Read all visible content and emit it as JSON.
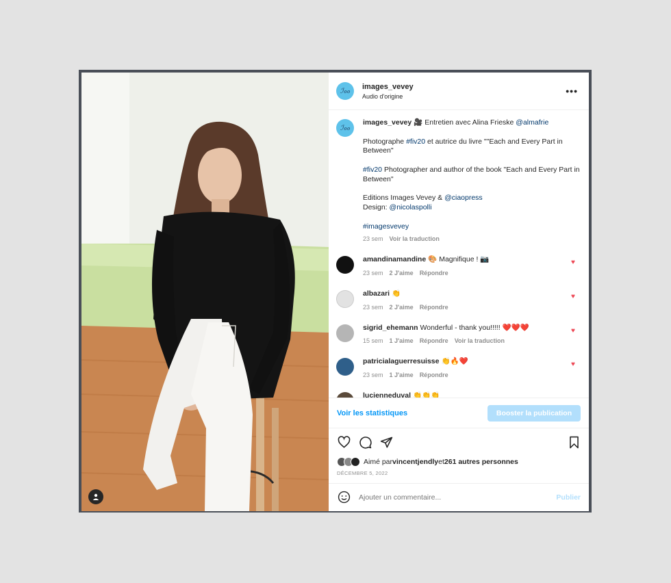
{
  "post": {
    "username": "images_vevey",
    "audio": "Audio d'origine",
    "more": "•••"
  },
  "caption": {
    "username": "images_vevey",
    "emoji": "🎥",
    "line1_text": " Entretien avec Alina Frieske ",
    "line1_mention": "@almafrie",
    "p2_prefix": "Photographe ",
    "p2_tag": "#fiv20",
    "p2_rest": " et autrice du livre \"\"Each and Every Part in Between\"",
    "p3_tag": "#fiv20",
    "p3_rest": " Photographer and author of the book \"Each and Every Part in Between\"",
    "p4_prefix": "Editions Images Vevey & ",
    "p4_mention": "@ciaopress",
    "p5_prefix": "Design: ",
    "p5_mention": "@nicolaspolli",
    "p6_tag": "#imagesvevey",
    "time": "23 sem",
    "translate": "Voir la traduction"
  },
  "comments": [
    {
      "username": "amandinamandine",
      "text": "🎨 Magnifique ! 📷",
      "time": "23 sem",
      "likes": "2 J'aime",
      "reply": "Répondre",
      "translate": "",
      "avatar_color": "#111111"
    },
    {
      "username": "albazari",
      "text": "👏",
      "time": "23 sem",
      "likes": "2 J'aime",
      "reply": "Répondre",
      "translate": "",
      "avatar_color": "#d9d9d9"
    },
    {
      "username": "sigrid_ehemann",
      "text": "Wonderful - thank you!!!!! ❤️❤️❤️",
      "time": "15 sem",
      "likes": "1 J'aime",
      "reply": "Répondre",
      "translate": "Voir la traduction",
      "avatar_color": "#b5b5b5"
    },
    {
      "username": "patricialaguerresuisse",
      "text": "👏🔥❤️",
      "time": "23 sem",
      "likes": "1 J'aime",
      "reply": "Répondre",
      "translate": "",
      "avatar_color": "#2f5f8a"
    },
    {
      "username": "lucienneduval",
      "text": "👏👏👏",
      "time": "",
      "likes": "",
      "reply": "",
      "translate": "",
      "avatar_color": "#5a4a3a"
    }
  ],
  "stats": {
    "link": "Voir les statistiques",
    "boost": "Booster la publication"
  },
  "likes": {
    "prefix": "Aimé par ",
    "user": "vincentjendly",
    "middle": " et ",
    "others": "261 autres personnes",
    "date": "DÉCEMBRE 5, 2022"
  },
  "add_comment": {
    "placeholder": "Ajouter un commentaire...",
    "publish": "Publier"
  },
  "icons": {
    "more": "more-options-icon",
    "heart": "heart-icon",
    "comment": "comment-icon",
    "share": "share-icon",
    "save": "bookmark-icon",
    "emoji": "emoji-icon",
    "user_tag": "user-tag-icon"
  },
  "colors": {
    "link": "#00376b",
    "accent": "#0095f6",
    "boost_disabled": "#b2dffc",
    "like_red": "#ed4956",
    "avatar_brand": "#5ec2ea"
  }
}
